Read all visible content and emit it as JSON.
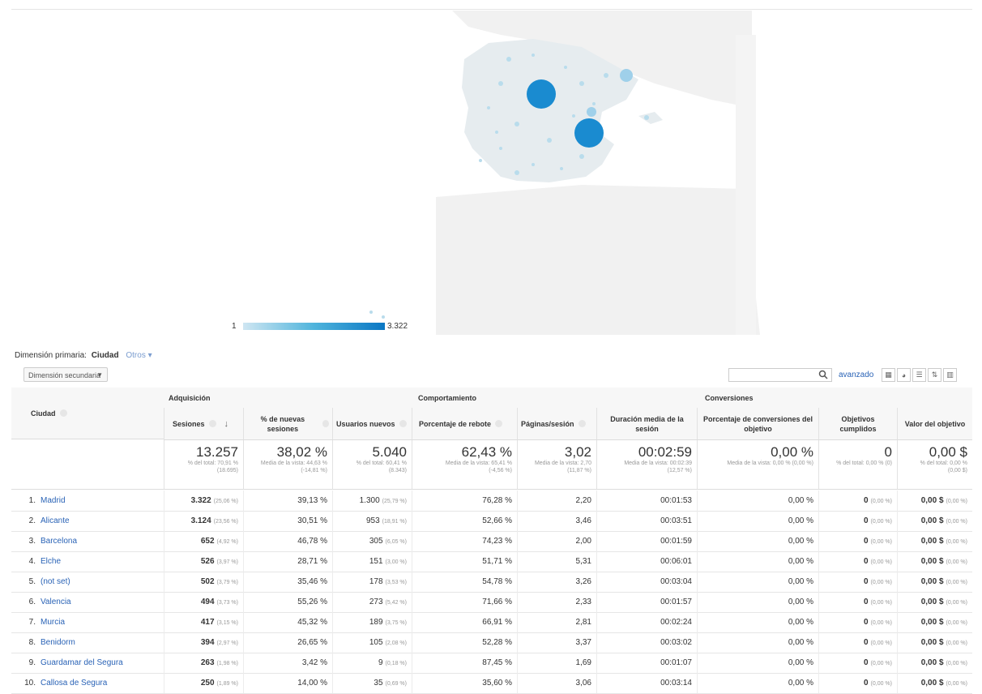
{
  "legend": {
    "min": "1",
    "max": "3.322"
  },
  "dimension": {
    "label": "Dimensión primaria:",
    "value": "Ciudad",
    "other": "Otros"
  },
  "secondary_dimension": {
    "label": "Dimensión secundaria"
  },
  "search": {
    "placeholder": "",
    "advanced": "avanzado"
  },
  "groups": {
    "acquisition": "Adquisición",
    "behavior": "Comportamiento",
    "conversions": "Conversiones"
  },
  "columns": {
    "city": "Ciudad",
    "sessions": "Sesiones",
    "new_sessions": "% de nuevas sesiones",
    "new_users": "Usuarios nuevos",
    "bounce": "Porcentaje de rebote",
    "pages": "Páginas/sesión",
    "duration": "Duración media de la sesión",
    "conv_rate": "Porcentaje de conversiones del objetivo",
    "goals": "Objetivos cumplidos",
    "goal_value": "Valor del objetivo"
  },
  "totals": {
    "sessions": {
      "value": "13.257",
      "sub1": "% del total: 70,91 %",
      "sub2": "(18.695)"
    },
    "new_sessions": {
      "value": "38,02 %",
      "sub1": "Media de la vista: 44,63 %",
      "sub2": "(-14,81 %)"
    },
    "new_users": {
      "value": "5.040",
      "sub1": "% del total: 60,41 %",
      "sub2": "(8.343)"
    },
    "bounce": {
      "value": "62,43 %",
      "sub1": "Media de la vista: 65,41 %",
      "sub2": "(-4,56 %)"
    },
    "pages": {
      "value": "3,02",
      "sub1": "Media de la vista: 2,70",
      "sub2": "(11,87 %)"
    },
    "duration": {
      "value": "00:02:59",
      "sub1": "Media de la vista: 00:02:39",
      "sub2": "(12,57 %)"
    },
    "conv_rate": {
      "value": "0,00 %",
      "sub1": "Media de la vista: 0,00 % (0,00 %)",
      "sub2": ""
    },
    "goals": {
      "value": "0",
      "sub1": "% del total: 0,00 % (0)",
      "sub2": ""
    },
    "goal_value": {
      "value": "0,00 $",
      "sub1": "% del total: 0,00 %",
      "sub2": "(0,00 $)"
    }
  },
  "rows": [
    {
      "n": "1.",
      "city": "Madrid",
      "sessions": "3.322",
      "sessions_pct": "(25,06 %)",
      "new_sessions": "39,13 %",
      "new_users": "1.300",
      "new_users_pct": "(25,79 %)",
      "bounce": "76,28 %",
      "pages": "2,20",
      "duration": "00:01:53",
      "conv": "0,00 %",
      "goals": "0",
      "goals_pct": "(0,00 %)",
      "value": "0,00 $",
      "value_pct": "(0,00 %)"
    },
    {
      "n": "2.",
      "city": "Alicante",
      "sessions": "3.124",
      "sessions_pct": "(23,56 %)",
      "new_sessions": "30,51 %",
      "new_users": "953",
      "new_users_pct": "(18,91 %)",
      "bounce": "52,66 %",
      "pages": "3,46",
      "duration": "00:03:51",
      "conv": "0,00 %",
      "goals": "0",
      "goals_pct": "(0,00 %)",
      "value": "0,00 $",
      "value_pct": "(0,00 %)"
    },
    {
      "n": "3.",
      "city": "Barcelona",
      "sessions": "652",
      "sessions_pct": "(4,92 %)",
      "new_sessions": "46,78 %",
      "new_users": "305",
      "new_users_pct": "(6,05 %)",
      "bounce": "74,23 %",
      "pages": "2,00",
      "duration": "00:01:59",
      "conv": "0,00 %",
      "goals": "0",
      "goals_pct": "(0,00 %)",
      "value": "0,00 $",
      "value_pct": "(0,00 %)"
    },
    {
      "n": "4.",
      "city": "Elche",
      "sessions": "526",
      "sessions_pct": "(3,97 %)",
      "new_sessions": "28,71 %",
      "new_users": "151",
      "new_users_pct": "(3,00 %)",
      "bounce": "51,71 %",
      "pages": "5,31",
      "duration": "00:06:01",
      "conv": "0,00 %",
      "goals": "0",
      "goals_pct": "(0,00 %)",
      "value": "0,00 $",
      "value_pct": "(0,00 %)"
    },
    {
      "n": "5.",
      "city": "(not set)",
      "sessions": "502",
      "sessions_pct": "(3,79 %)",
      "new_sessions": "35,46 %",
      "new_users": "178",
      "new_users_pct": "(3,53 %)",
      "bounce": "54,78 %",
      "pages": "3,26",
      "duration": "00:03:04",
      "conv": "0,00 %",
      "goals": "0",
      "goals_pct": "(0,00 %)",
      "value": "0,00 $",
      "value_pct": "(0,00 %)"
    },
    {
      "n": "6.",
      "city": "Valencia",
      "sessions": "494",
      "sessions_pct": "(3,73 %)",
      "new_sessions": "55,26 %",
      "new_users": "273",
      "new_users_pct": "(5,42 %)",
      "bounce": "71,66 %",
      "pages": "2,33",
      "duration": "00:01:57",
      "conv": "0,00 %",
      "goals": "0",
      "goals_pct": "(0,00 %)",
      "value": "0,00 $",
      "value_pct": "(0,00 %)"
    },
    {
      "n": "7.",
      "city": "Murcia",
      "sessions": "417",
      "sessions_pct": "(3,15 %)",
      "new_sessions": "45,32 %",
      "new_users": "189",
      "new_users_pct": "(3,75 %)",
      "bounce": "66,91 %",
      "pages": "2,81",
      "duration": "00:02:24",
      "conv": "0,00 %",
      "goals": "0",
      "goals_pct": "(0,00 %)",
      "value": "0,00 $",
      "value_pct": "(0,00 %)"
    },
    {
      "n": "8.",
      "city": "Benidorm",
      "sessions": "394",
      "sessions_pct": "(2,97 %)",
      "new_sessions": "26,65 %",
      "new_users": "105",
      "new_users_pct": "(2,08 %)",
      "bounce": "52,28 %",
      "pages": "3,37",
      "duration": "00:03:02",
      "conv": "0,00 %",
      "goals": "0",
      "goals_pct": "(0,00 %)",
      "value": "0,00 $",
      "value_pct": "(0,00 %)"
    },
    {
      "n": "9.",
      "city": "Guardamar del Segura",
      "sessions": "263",
      "sessions_pct": "(1,98 %)",
      "new_sessions": "3,42 %",
      "new_users": "9",
      "new_users_pct": "(0,18 %)",
      "bounce": "87,45 %",
      "pages": "1,69",
      "duration": "00:01:07",
      "conv": "0,00 %",
      "goals": "0",
      "goals_pct": "(0,00 %)",
      "value": "0,00 $",
      "value_pct": "(0,00 %)"
    },
    {
      "n": "10.",
      "city": "Callosa de Segura",
      "sessions": "250",
      "sessions_pct": "(1,89 %)",
      "new_sessions": "14,00 %",
      "new_users": "35",
      "new_users_pct": "(0,69 %)",
      "bounce": "35,60 %",
      "pages": "3,06",
      "duration": "00:03:14",
      "conv": "0,00 %",
      "goals": "0",
      "goals_pct": "(0,00 %)",
      "value": "0,00 $",
      "value_pct": "(0,00 %)"
    }
  ]
}
